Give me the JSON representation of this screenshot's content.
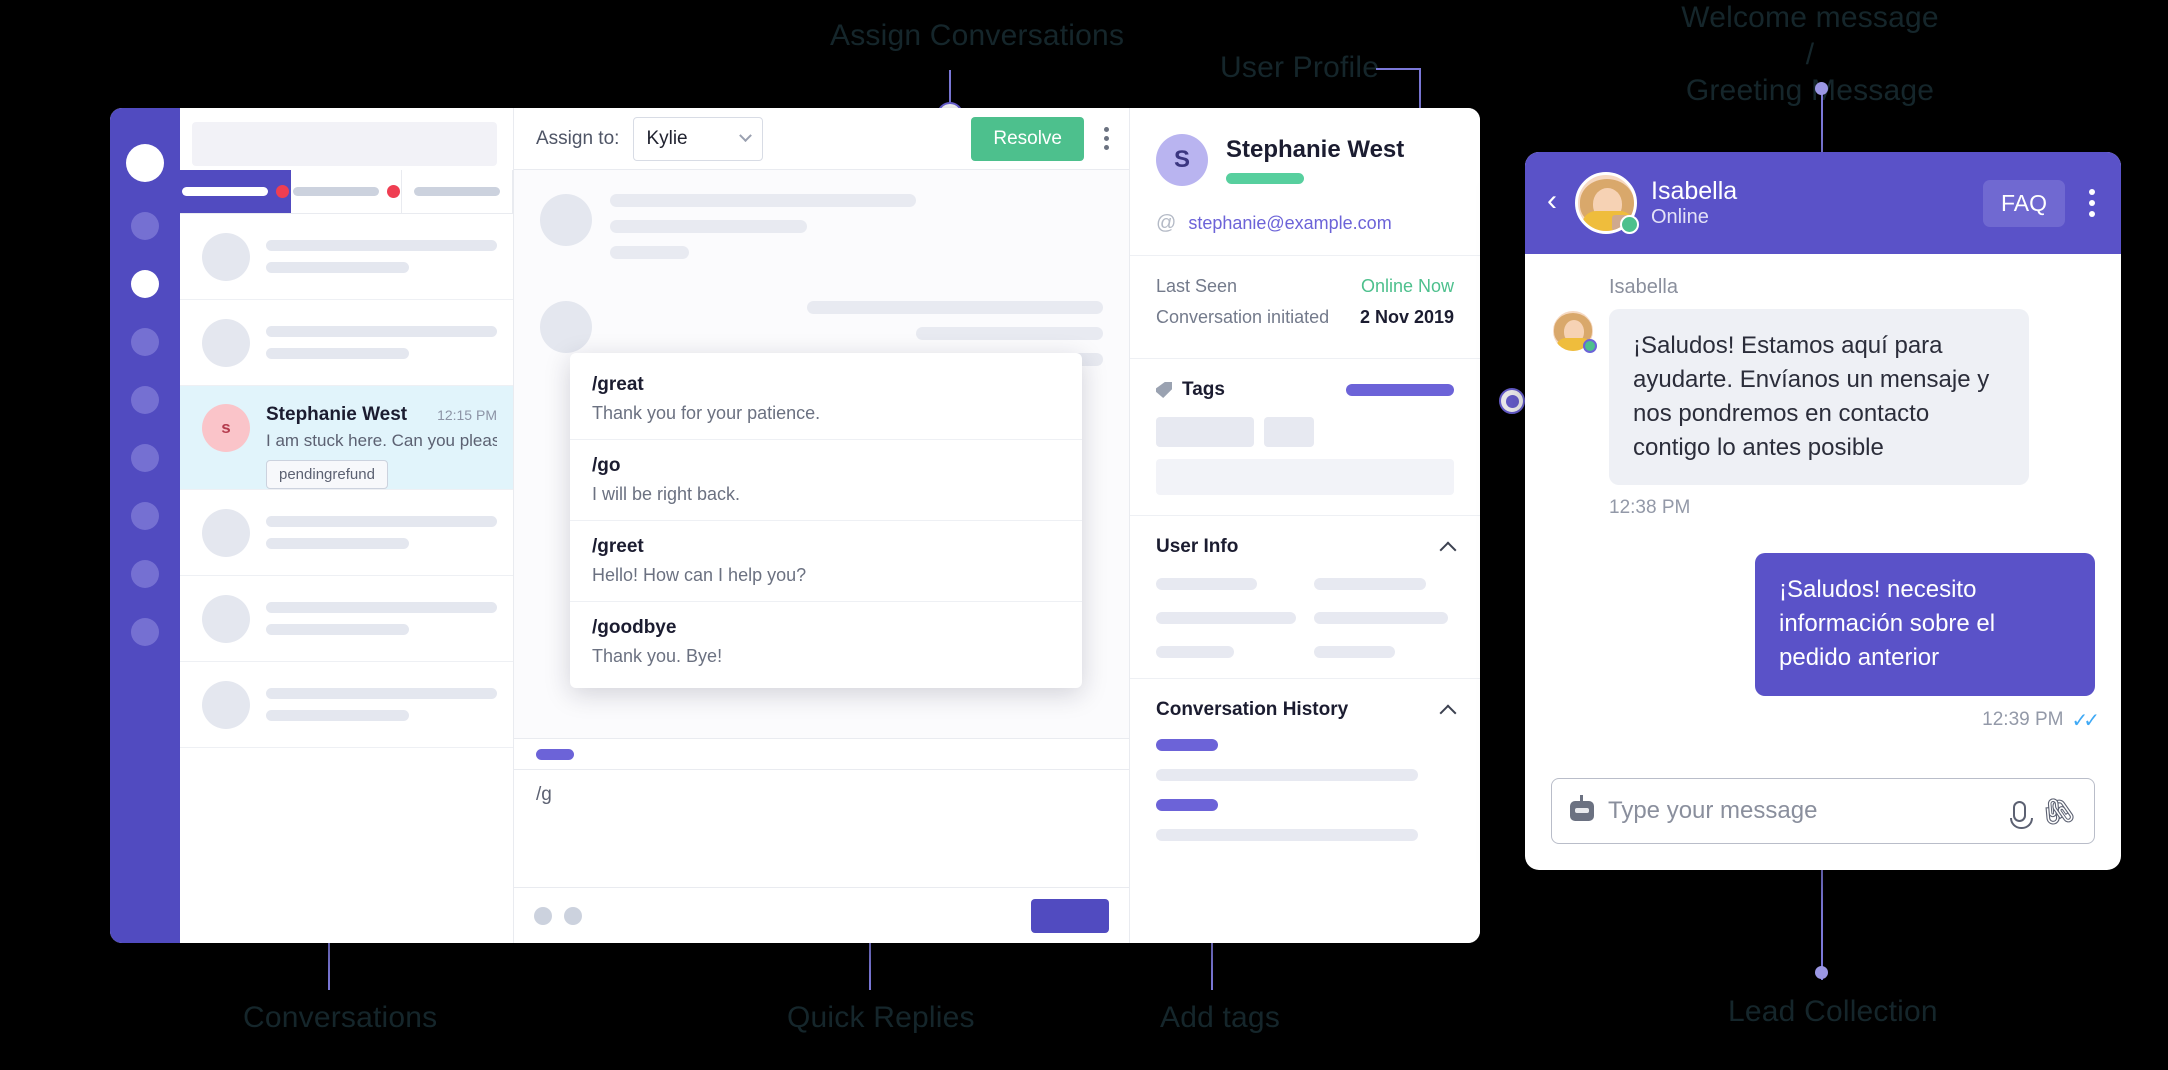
{
  "annotations": [
    {
      "id": "assign-conversations",
      "label": "Assign Conversations"
    },
    {
      "id": "user-profile",
      "label": "User Profile"
    },
    {
      "id": "welcome-message",
      "label": "Welcome message /\nGreeting Message"
    },
    {
      "id": "conversations",
      "label": "Conversations"
    },
    {
      "id": "quick-replies",
      "label": "Quick Replies"
    },
    {
      "id": "add-tags",
      "label": "Add tags"
    },
    {
      "id": "lead-collection",
      "label": "Lead Collection"
    }
  ],
  "dashboard": {
    "search": {
      "placeholder": ""
    },
    "tabs": [
      {
        "label": "",
        "active": true,
        "badge": true
      },
      {
        "label": "",
        "active": false,
        "badge": true
      },
      {
        "label": "",
        "active": false,
        "badge": false
      }
    ],
    "selected_conversation": {
      "avatar_initial": "s",
      "name": "Stephanie West",
      "time": "12:15 PM",
      "snippet": "I am stuck here. Can you pleas...",
      "tag": "pendingrefund"
    },
    "toolbar": {
      "assign_label": "Assign to:",
      "assignee": "Kylie",
      "resolve_label": "Resolve",
      "more_icon": "kebab-icon"
    },
    "composer": {
      "value": "/g"
    },
    "quick_replies": [
      {
        "command": "/great",
        "text": "Thank you for your patience."
      },
      {
        "command": "/go",
        "text": "I will be right back."
      },
      {
        "command": "/greet",
        "text": "Hello! How can I help you?"
      },
      {
        "command": "/goodbye",
        "text": "Thank you. Bye!"
      }
    ],
    "user_panel": {
      "avatar_initial": "S",
      "name": "Stephanie West",
      "email": "stephanie@example.com",
      "at_icon": "at-icon",
      "meta": [
        {
          "key": "Last Seen",
          "value": "Online Now",
          "accent": true
        },
        {
          "key": "Conversation initiated",
          "value": "2 Nov 2019",
          "accent": false
        }
      ],
      "sections": [
        {
          "title": "Tags",
          "icon": "tag-icon"
        },
        {
          "title": "User Info",
          "icon": "chevron-up-icon"
        },
        {
          "title": "Conversation History",
          "icon": "chevron-up-icon"
        }
      ]
    }
  },
  "widget": {
    "back_icon": "chevron-left-icon",
    "agent_name": "Isabella",
    "agent_status": "Online",
    "faq_label": "FAQ",
    "more_icon": "kebab-icon",
    "messages": [
      {
        "from": "agent",
        "sender": "Isabella",
        "text": "¡Saludos! Estamos aquí para ayudarte. Envíanos un mensaje y nos pondremos en contacto contigo lo antes posible",
        "time": "12:38 PM"
      },
      {
        "from": "user",
        "text": "¡Saludos! necesito información sobre el pedido anterior",
        "time": "12:39 PM",
        "read_icon": "double-check-icon"
      }
    ],
    "input": {
      "placeholder": "Type your message",
      "bot_icon": "robot-icon",
      "mic_icon": "microphone-icon",
      "attach_icon": "paperclip-icon"
    }
  },
  "colors": {
    "brand": "#514bc0",
    "widget_header": "#5a52c8",
    "accent_green": "#4dc08d",
    "badge_red": "#ef3e52",
    "selected_row": "#e1f4fb",
    "annotation": "#15262b"
  }
}
